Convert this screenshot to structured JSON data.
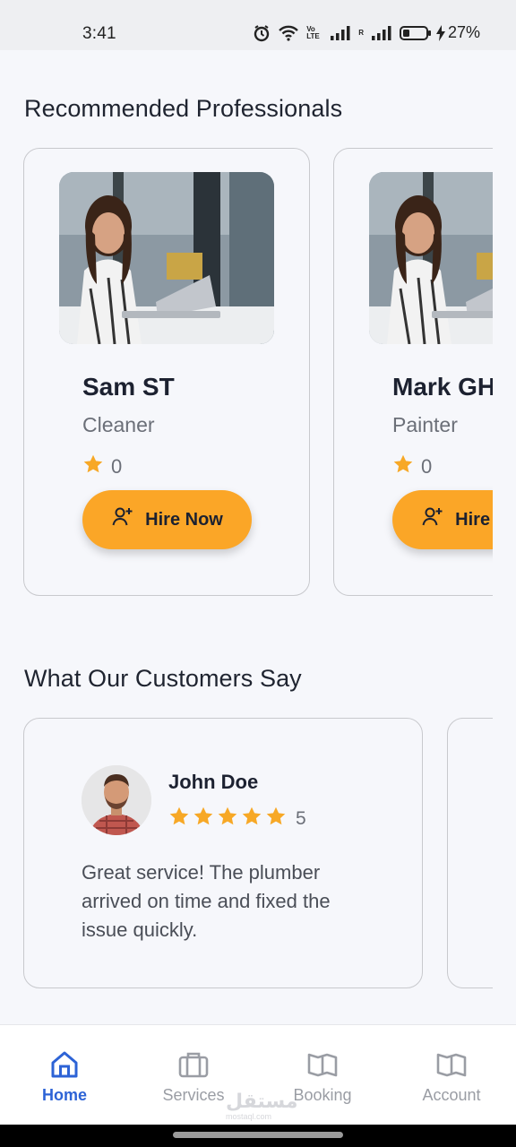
{
  "status_bar": {
    "time": "3:41",
    "battery": "27%",
    "volte_label": "Vo LTE",
    "roaming_label": "R"
  },
  "professionals": {
    "title": "Recommended Professionals",
    "items": [
      {
        "name": "Sam ST",
        "role": "Cleaner",
        "rating": "0",
        "button_label": "Hire Now"
      },
      {
        "name": "Mark GH",
        "role": "Painter",
        "rating": "0",
        "button_label": "Hire Now"
      }
    ]
  },
  "testimonials": {
    "title": "What Our Customers Say",
    "items": [
      {
        "name": "John Doe",
        "stars": 5,
        "score": "5",
        "text": "Great service! The plumber arrived on time and fixed the issue quickly."
      }
    ]
  },
  "bottom_nav": {
    "items": [
      {
        "label": "Home",
        "icon": "home-icon",
        "active": true
      },
      {
        "label": "Services",
        "icon": "briefcase-icon",
        "active": false
      },
      {
        "label": "Booking",
        "icon": "book-icon",
        "active": false
      },
      {
        "label": "Account",
        "icon": "book-icon",
        "active": false
      }
    ]
  },
  "watermark": {
    "text": "مستقل",
    "sub": "mostaql.com"
  },
  "colors": {
    "accent": "#fba627",
    "active_nav": "#2d63d6",
    "inactive_nav": "#9a9da4",
    "star": "#f7a826"
  }
}
